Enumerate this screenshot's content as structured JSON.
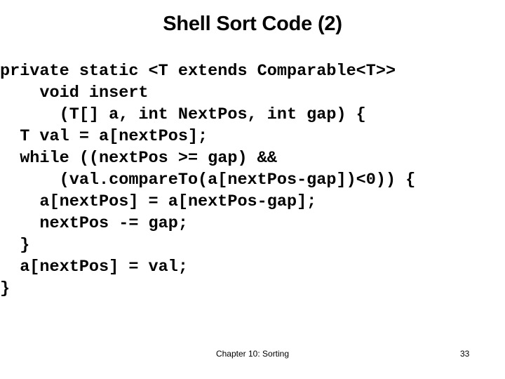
{
  "slide": {
    "title": "Shell Sort Code (2)",
    "background_color": "#ffffff",
    "text_color": "#000000"
  },
  "code": {
    "language": "java",
    "lines": [
      "private static <T extends Comparable<T>>",
      "    void insert",
      "      (T[] a, int NextPos, int gap) {",
      "  T val = a[nextPos];",
      "  while ((nextPos >= gap) &&",
      "      (val.compareTo(a[nextPos-gap])<0)) {",
      "    a[nextPos] = a[nextPos-gap];",
      "    nextPos -= gap;",
      "  }",
      "  a[nextPos] = val;",
      "}"
    ]
  },
  "footer": {
    "chapter": "Chapter 10: Sorting",
    "page_number": "33"
  }
}
